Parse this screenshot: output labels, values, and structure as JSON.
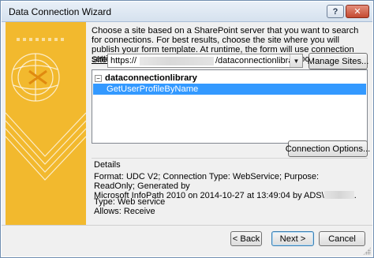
{
  "window": {
    "title": "Data Connection Wizard",
    "help_label": "?",
    "close_label": "✕"
  },
  "intro_text": "Choose a site based on a SharePoint server that you want to search for connections. For best results, choose the site where you will publish your form template. At runtime, the form will use connection settings from the Data Connection Library that you choose.",
  "site": {
    "label": "Site:",
    "value_prefix": "https://",
    "value_suffix": "/dataconnectionlibrary",
    "dropdown_icon": "▼"
  },
  "buttons": {
    "manage_sites": "Manage Sites...",
    "connection_options": "Connection Options...",
    "back": "< Back",
    "next": "Next >",
    "cancel": "Cancel"
  },
  "tree": {
    "root_expander": "−",
    "root_label": "dataconnectionlibrary",
    "items": [
      "GetUserProfileByName"
    ]
  },
  "details": {
    "label": "Details",
    "format_line_1": "Format: UDC V2; Connection Type: WebService; Purpose: ReadOnly; Generated by",
    "format_line_2_prefix": "Microsoft InfoPath 2010 on 2014-10-27 at 13:49:04 by ADS\\",
    "format_line_2_suffix": ".",
    "type_line": "Type:  Web service",
    "allows_line": "Allows:  Receive"
  },
  "colors": {
    "accent_yellow": "#f2b92e",
    "selection_blue": "#3399ff"
  }
}
